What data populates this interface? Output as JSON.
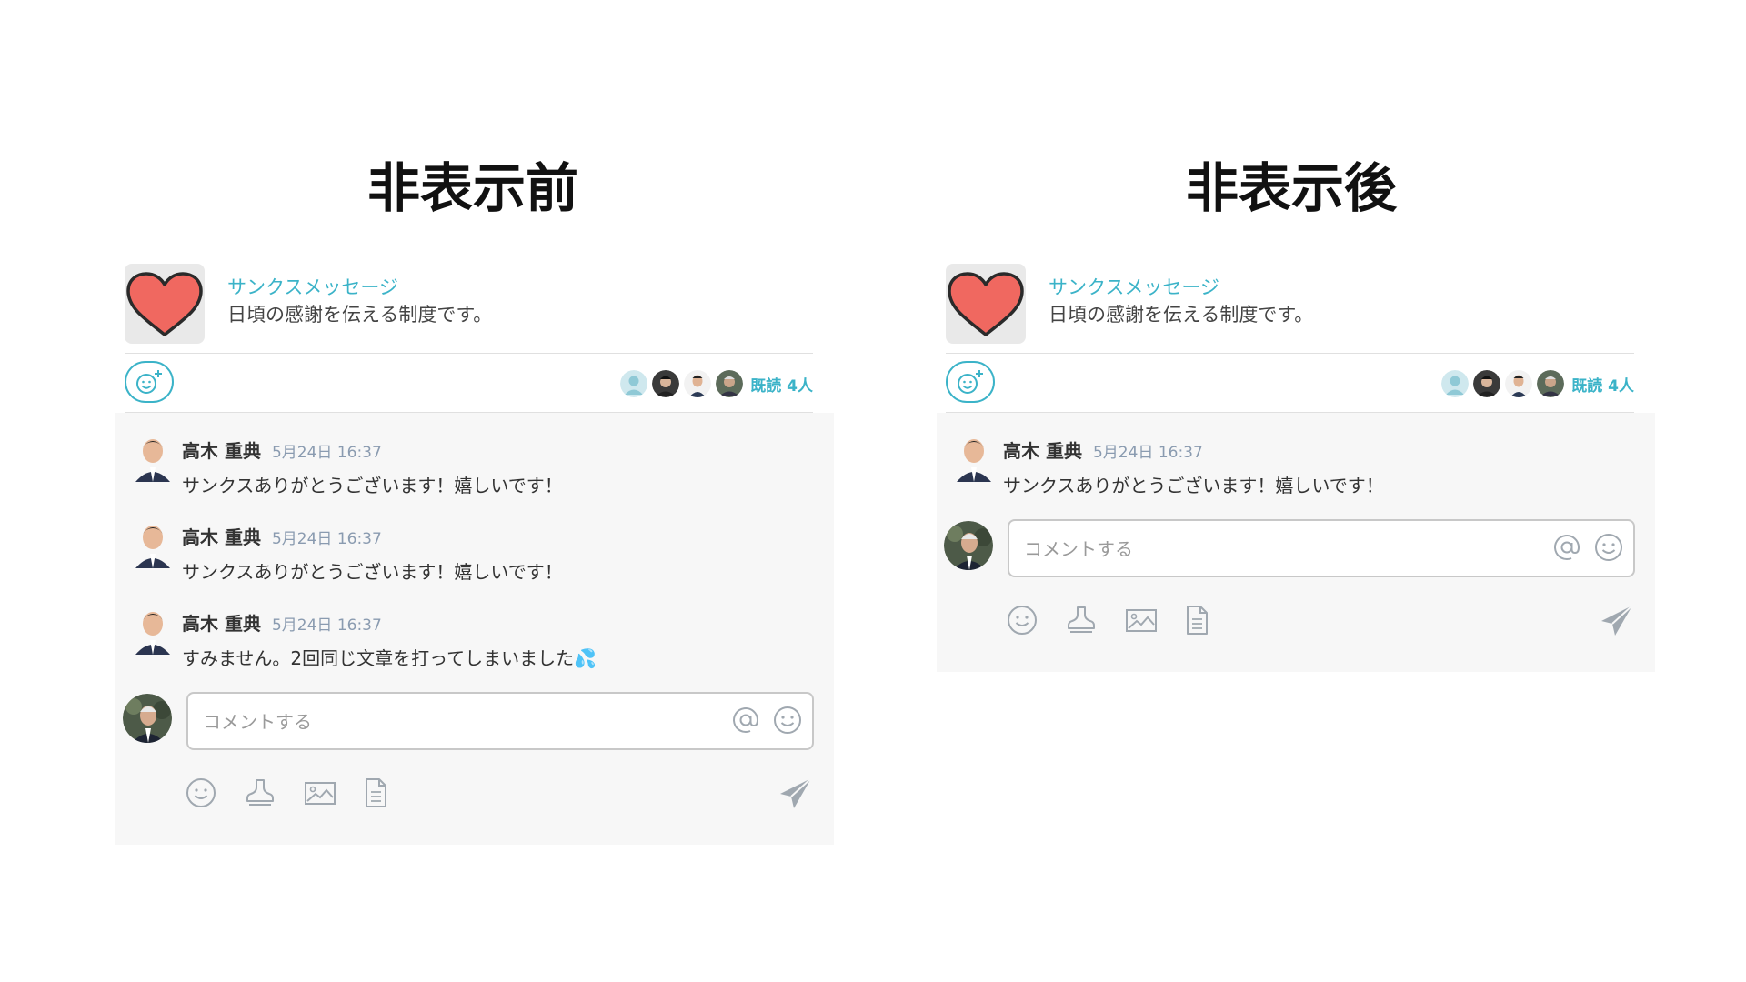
{
  "panels": {
    "before": {
      "title": "非表示前",
      "header": {
        "title": "サンクスメッセージ",
        "description": "日頃の感謝を伝える制度です。"
      },
      "read_label": "既読 4人",
      "comments": [
        {
          "author": "高木 重典",
          "time": "5月24日 16:37",
          "text": "サンクスありがとうございます！嬉しいです！"
        },
        {
          "author": "高木 重典",
          "time": "5月24日 16:37",
          "text": "サンクスありがとうございます！嬉しいです！"
        },
        {
          "author": "高木 重典",
          "time": "5月24日 16:37",
          "text": "すみません。2回同じ文章を打ってしまいました💦"
        }
      ],
      "input": {
        "placeholder": "コメントする"
      }
    },
    "after": {
      "title": "非表示後",
      "header": {
        "title": "サンクスメッセージ",
        "description": "日頃の感謝を伝える制度です。"
      },
      "read_label": "既読 4人",
      "comments": [
        {
          "author": "高木 重典",
          "time": "5月24日 16:37",
          "text": "サンクスありがとうございます！嬉しいです！"
        }
      ],
      "input": {
        "placeholder": "コメントする"
      }
    }
  },
  "colors": {
    "accent": "#3bb3c8",
    "heart": "#f06860",
    "panel_bg": "#f7f7f7",
    "icon_gray": "#a0a8b0"
  },
  "icons": [
    "heart-icon",
    "add-reaction-icon",
    "at-icon",
    "emoji-icon",
    "stamp-icon",
    "image-icon",
    "file-icon",
    "send-icon"
  ]
}
